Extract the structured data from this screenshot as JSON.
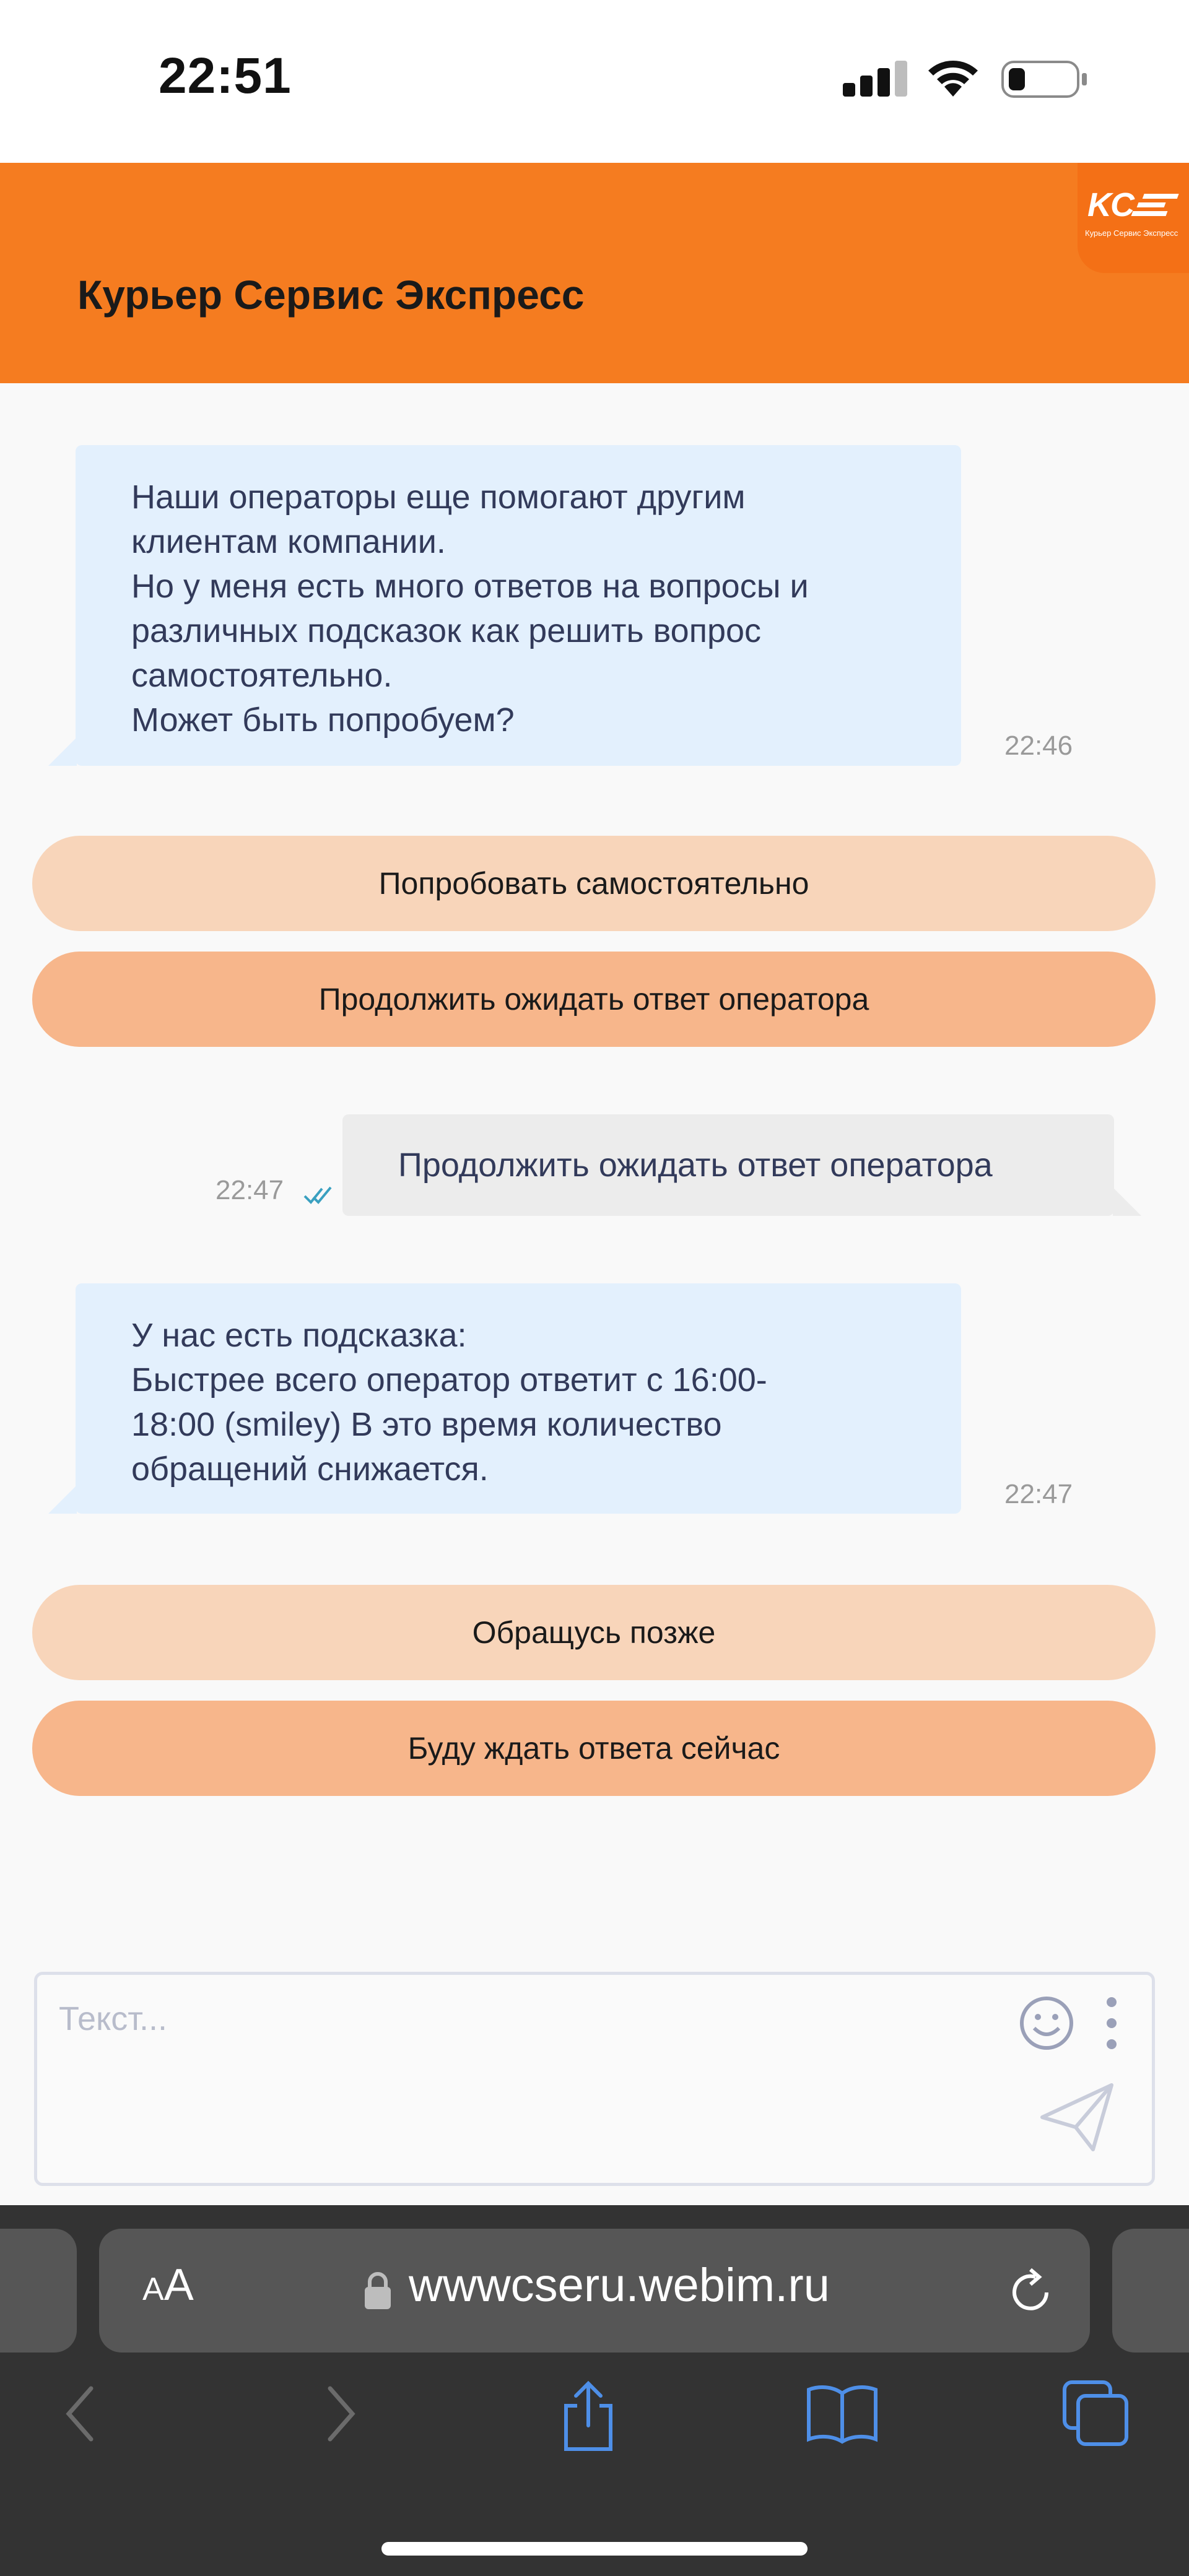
{
  "status_bar": {
    "time": "22:51",
    "icons": [
      "cellular-signal-icon",
      "wifi-icon",
      "battery-icon"
    ]
  },
  "header": {
    "title": "Курьер Сервис Экспресс",
    "logo_mark": "KCE",
    "logo_subtitle": "Курьер Сервис Экспресс",
    "background_color": "#f57c20"
  },
  "messages": [
    {
      "direction": "incoming",
      "lines": [
        "Наши операторы еще помогают другим",
        "клиентам компании.",
        "Но у меня есть много ответов на вопросы и",
        "различных подсказок как решить вопрос",
        "самостоятельно.",
        "Может быть попробуем?"
      ],
      "time": "22:46"
    },
    {
      "direction": "outgoing",
      "lines": [
        "Продолжить ожидать ответ оператора"
      ],
      "time": "22:47",
      "status_icon": "double-check-icon"
    },
    {
      "direction": "incoming",
      "lines": [
        "У нас есть подсказка:",
        "Быстрее всего оператор ответит с 16:00-",
        "18:00 (smiley) В это время количество",
        "обращений снижается."
      ],
      "time": "22:47"
    }
  ],
  "quick_replies_1": [
    "Попробовать самостоятельно",
    "Продолжить ожидать ответ оператора"
  ],
  "quick_replies_2": [
    "Обращусь позже",
    "Буду ждать ответа сейчас"
  ],
  "composer": {
    "placeholder": "Текст...",
    "icons": [
      "smiley-icon",
      "more-vertical-icon",
      "send-icon"
    ]
  },
  "browser": {
    "text_size_label": "AA",
    "url": "wwwcseru.webim.ru",
    "toolbar_icons": [
      "back-icon",
      "forward-icon",
      "share-icon",
      "bookmarks-icon",
      "tabs-icon"
    ]
  },
  "colors": {
    "accent": "#f57c20",
    "incoming_bubble": "#e3f0fd",
    "outgoing_bubble": "#ececec",
    "quick_reply_light": "#f8d5ba",
    "quick_reply_dark": "#f7b68b"
  }
}
